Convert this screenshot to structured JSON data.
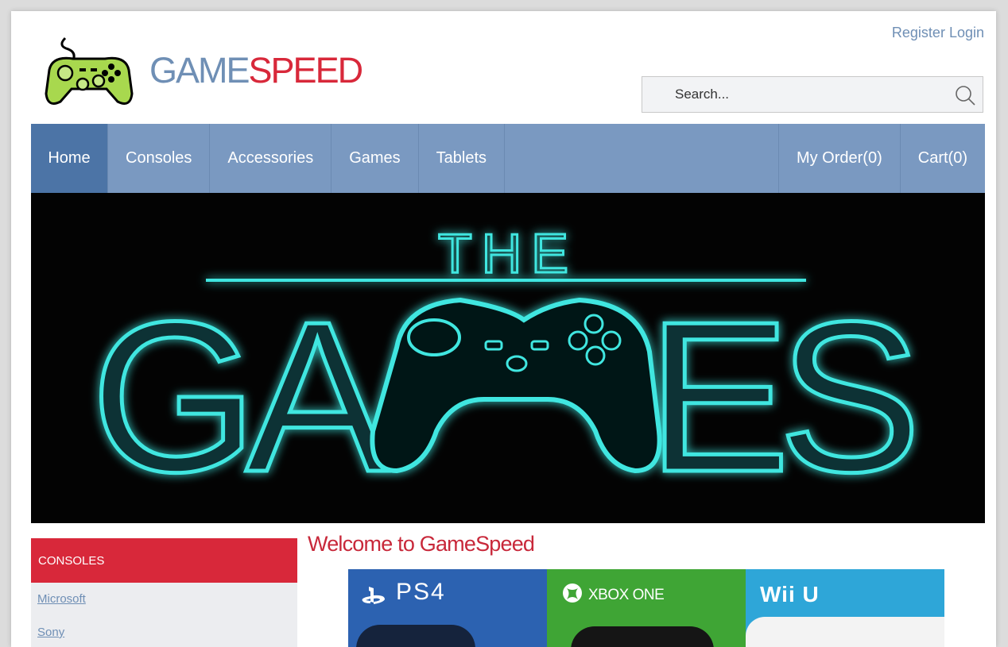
{
  "header": {
    "register_label": "Register",
    "login_label": "Login",
    "brand_part1": "GAME",
    "brand_part2": "SPEED",
    "logo_icon": "gamepad-icon"
  },
  "search": {
    "placeholder": "Search...",
    "icon": "search-icon"
  },
  "nav": {
    "items": [
      {
        "label": "Home",
        "active": true
      },
      {
        "label": "Consoles"
      },
      {
        "label": "Accessories"
      },
      {
        "label": "Games"
      },
      {
        "label": "Tablets"
      }
    ],
    "right_items": [
      {
        "label": "My Order(0)"
      },
      {
        "label": "Cart(0)"
      }
    ]
  },
  "hero": {
    "small_text": "THE",
    "letters": [
      "G",
      "A",
      "E",
      "S"
    ]
  },
  "sidebar": {
    "heading": "CONSOLES",
    "links": [
      "Microsoft",
      "Sony"
    ]
  },
  "main": {
    "welcome": "Welcome to GameSpeed",
    "tiles": [
      {
        "label": "PS4",
        "name": "ps4"
      },
      {
        "label": "XBOX ONE",
        "name": "xbox"
      },
      {
        "label": "Wii U",
        "name": "wiiu"
      }
    ]
  },
  "colors": {
    "accent_blue": "#7a99c1",
    "active_blue": "#4c74a6",
    "brand_red": "#d8283a",
    "neon": "#3fe6e0"
  }
}
